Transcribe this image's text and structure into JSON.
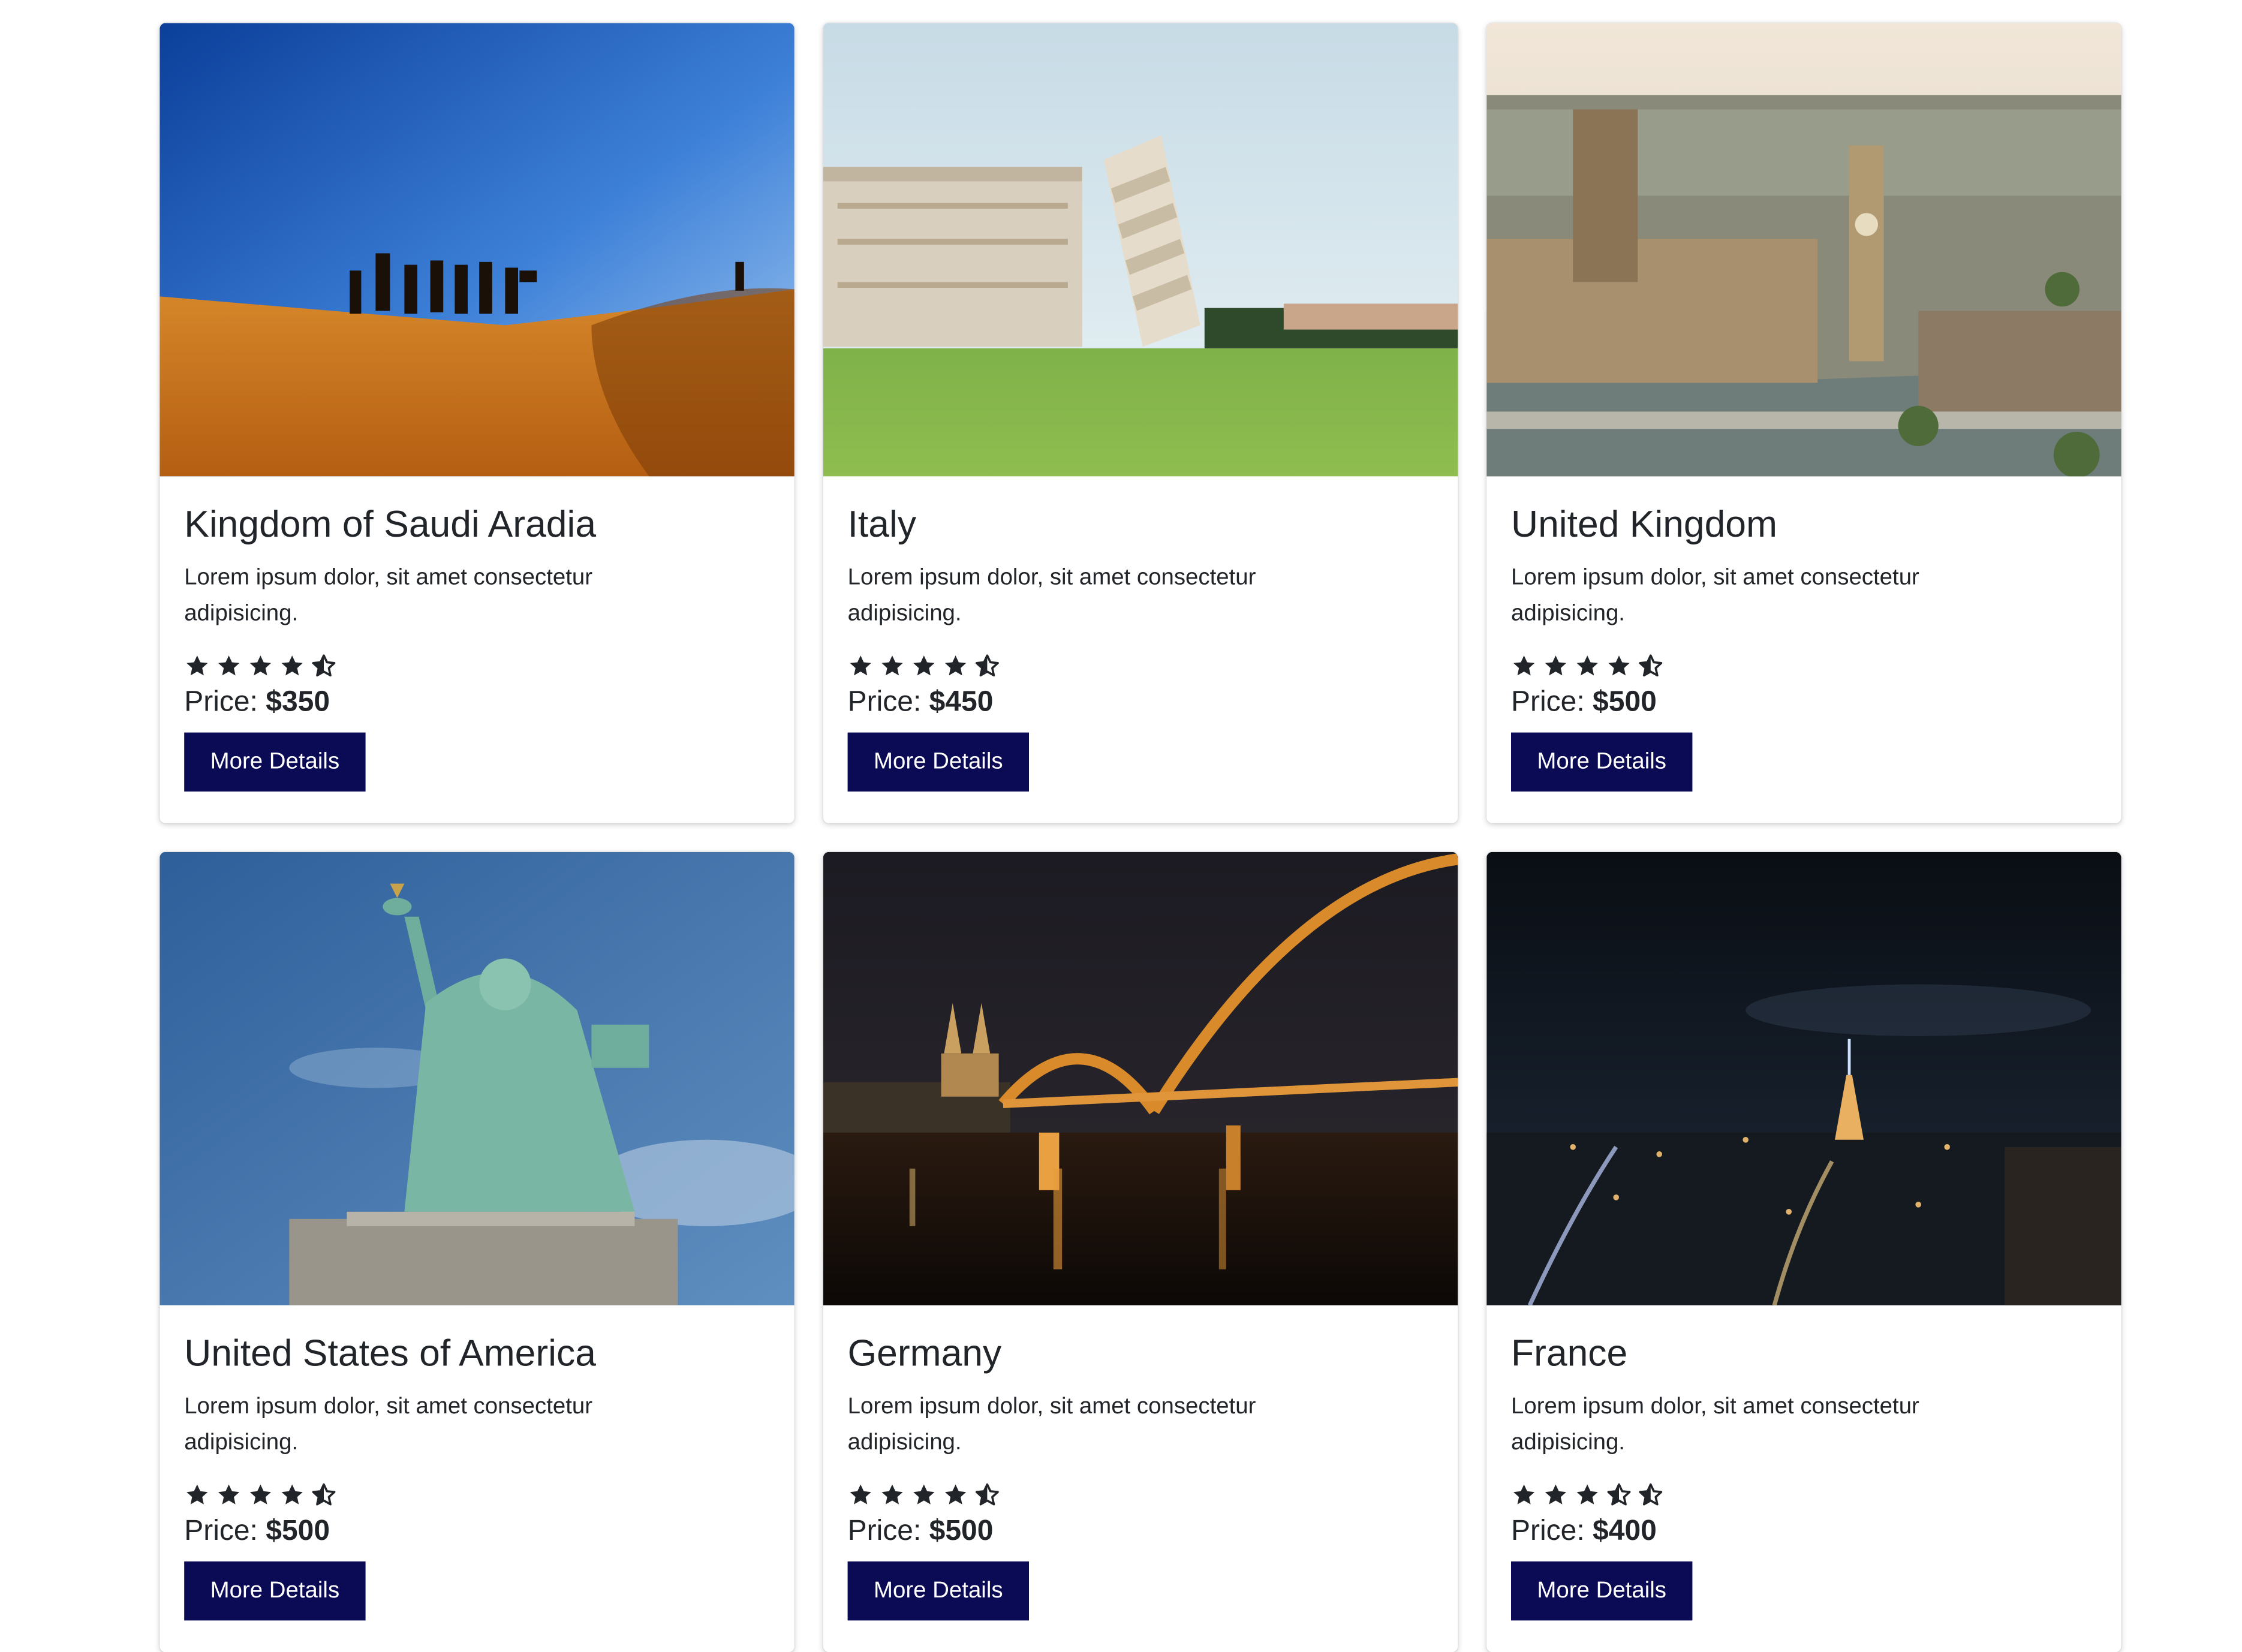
{
  "cards": [
    {
      "title": "Kingdom of Saudi Aradia",
      "description": "Lorem ipsum dolor, sit amet consectetur adipisicing.",
      "rating": 4.5,
      "stars": [
        "full",
        "full",
        "full",
        "full",
        "half"
      ],
      "price_label": "Price:",
      "price_value": "$350",
      "button_label": "More Details",
      "image": "desert-camel-caravan"
    },
    {
      "title": "Italy",
      "description": "Lorem ipsum dolor, sit amet consectetur adipisicing.",
      "rating": 4.5,
      "stars": [
        "full",
        "full",
        "full",
        "full",
        "half"
      ],
      "price_label": "Price:",
      "price_value": "$450",
      "button_label": "More Details",
      "image": "leaning-tower-of-pisa"
    },
    {
      "title": "United Kingdom",
      "description": "Lorem ipsum dolor, sit amet consectetur adipisicing.",
      "rating": 4.5,
      "stars": [
        "full",
        "full",
        "full",
        "full",
        "half"
      ],
      "price_label": "Price:",
      "price_value": "$500",
      "button_label": "More Details",
      "image": "london-westminster-aerial"
    },
    {
      "title": "United States of America",
      "description": "Lorem ipsum dolor, sit amet consectetur adipisicing.",
      "rating": 4.5,
      "stars": [
        "full",
        "full",
        "full",
        "full",
        "half"
      ],
      "price_label": "Price:",
      "price_value": "$500",
      "button_label": "More Details",
      "image": "statue-of-liberty"
    },
    {
      "title": "Germany",
      "description": "Lorem ipsum dolor, sit amet consectetur adipisicing.",
      "rating": 4.5,
      "stars": [
        "full",
        "full",
        "full",
        "full",
        "half"
      ],
      "price_label": "Price:",
      "price_value": "$500",
      "button_label": "More Details",
      "image": "cologne-bridge-night"
    },
    {
      "title": "France",
      "description": "Lorem ipsum dolor, sit amet consectetur adipisicing.",
      "rating": 3.5,
      "stars": [
        "full",
        "full",
        "full",
        "half",
        "half"
      ],
      "price_label": "Price:",
      "price_value": "$400",
      "button_label": "More Details",
      "image": "paris-eiffel-night"
    }
  ],
  "colors": {
    "button_bg": "#0b0b55",
    "button_text": "#ffffff",
    "text": "#212529",
    "star": "#212529"
  }
}
